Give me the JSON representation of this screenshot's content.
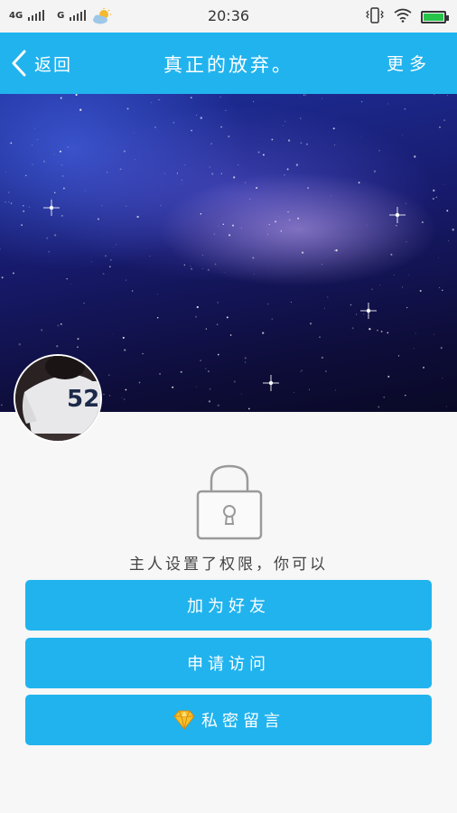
{
  "status_bar": {
    "network_1": "4G",
    "network_2": "G",
    "time": "20:36",
    "battery_color": "#27c449"
  },
  "nav": {
    "back_label": "返回",
    "title": "真正的放弃。",
    "more_label": "更多",
    "background_color": "#21b3ee"
  },
  "profile": {
    "avatar_jersey_number": "52"
  },
  "content": {
    "lock_icon": "lock-icon",
    "permission_text": "主人设置了权限，你可以",
    "actions": [
      {
        "label": "加为好友"
      },
      {
        "label": "申请访问"
      },
      {
        "label": "私密留言",
        "icon": "diamond-icon"
      }
    ],
    "button_color": "#21b3ee"
  }
}
